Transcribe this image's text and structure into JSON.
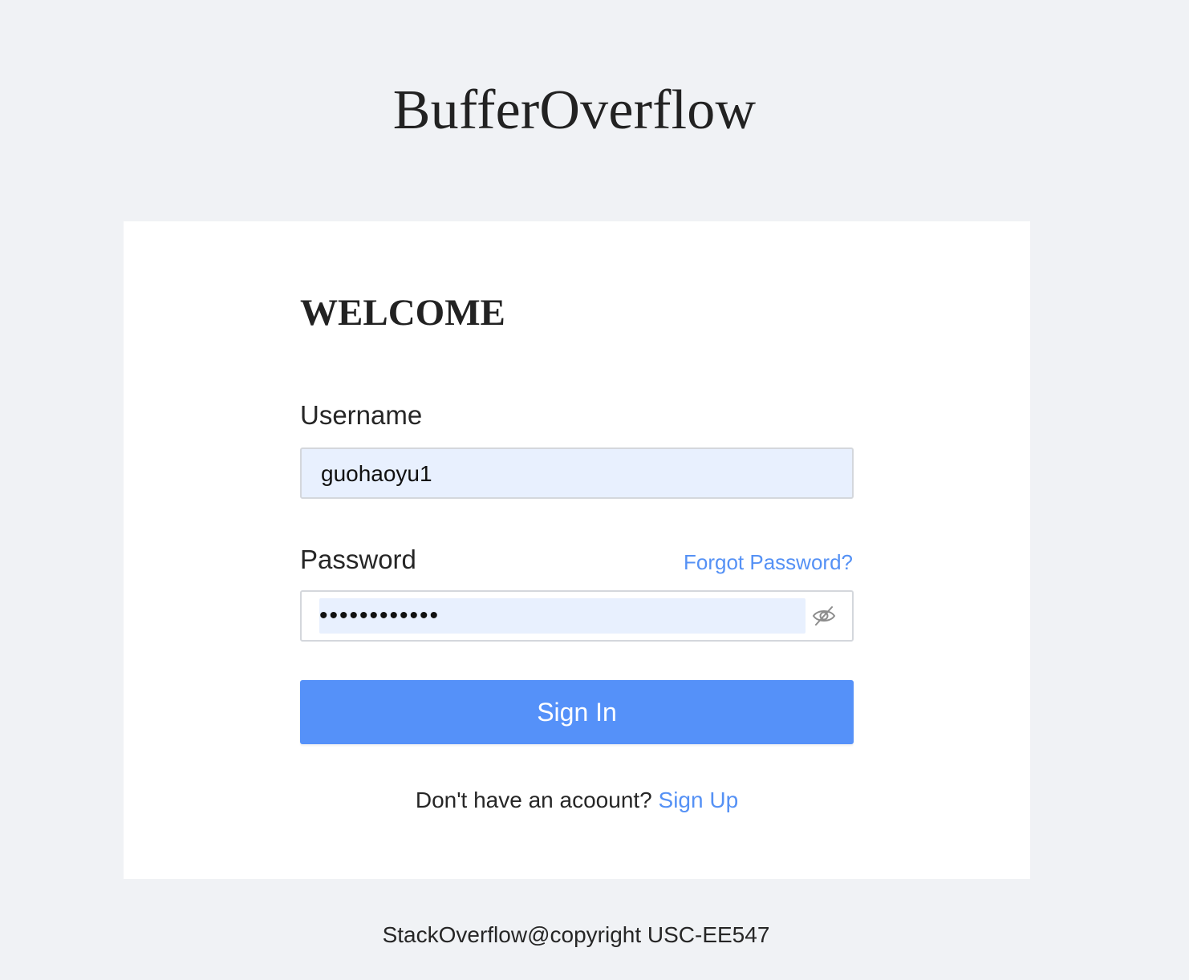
{
  "header": {
    "brand": "BufferOverflow"
  },
  "login": {
    "heading": "WELCOME",
    "username_label": "Username",
    "username_value": "guohaoyu1",
    "password_label": "Password",
    "password_value": "••••••••••••",
    "forgot_label": "Forgot Password?",
    "visibility_icon": "eye-off-icon",
    "signin_label": "Sign In",
    "signup_prompt": "Don't have an acoount?",
    "signup_label": "Sign Up"
  },
  "footer": {
    "text": "StackOverflow@copyright USC-EE547"
  },
  "colors": {
    "background": "#f0f2f5",
    "card": "#ffffff",
    "accent": "#5591f9",
    "link": "#5591f5",
    "autofill": "#e8f0fe"
  }
}
